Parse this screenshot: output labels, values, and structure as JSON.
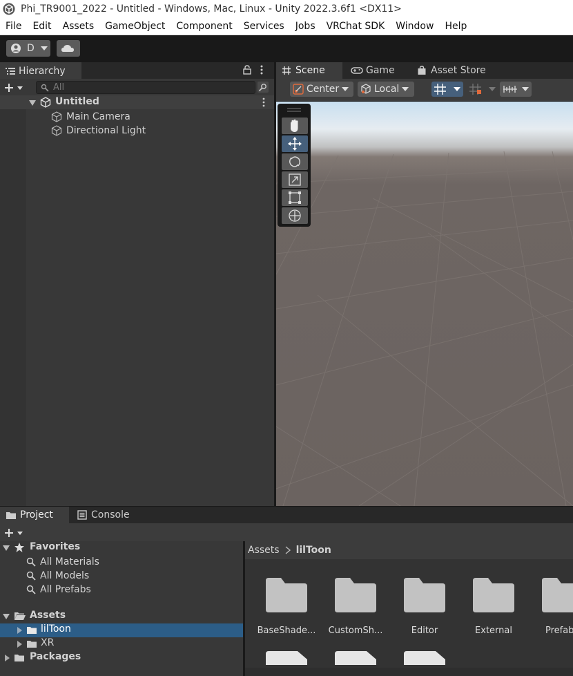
{
  "window": {
    "title": "Phi_TR9001_2022 - Untitled - Windows, Mac, Linux - Unity 2022.3.6f1 <DX11>"
  },
  "menu": [
    "File",
    "Edit",
    "Assets",
    "GameObject",
    "Component",
    "Services",
    "Jobs",
    "VRChat SDK",
    "Window",
    "Help"
  ],
  "toolbar": {
    "account_label": "D"
  },
  "hierarchy": {
    "tab_label": "Hierarchy",
    "search_placeholder": "All",
    "scene_name": "Untitled",
    "items": [
      "Main Camera",
      "Directional Light"
    ]
  },
  "scene_tabs": {
    "scene": "Scene",
    "game": "Game",
    "asset_store": "Asset Store"
  },
  "scene_toolbar": {
    "pivot_mode": "Center",
    "pivot_rotation": "Local"
  },
  "project": {
    "tab_label": "Project",
    "console_label": "Console",
    "favorites_label": "Favorites",
    "favorites": [
      "All Materials",
      "All Models",
      "All Prefabs"
    ],
    "assets_label": "Assets",
    "asset_children": [
      "lilToon",
      "XR"
    ],
    "packages_label": "Packages",
    "breadcrumb": [
      "Assets",
      "lilToon"
    ],
    "folders": [
      "BaseShade...",
      "CustomSh...",
      "Editor",
      "External",
      "Prefab"
    ]
  },
  "colors": {
    "selection": "#2c5d87",
    "active_tool": "#46607c",
    "panel": "#383838"
  }
}
